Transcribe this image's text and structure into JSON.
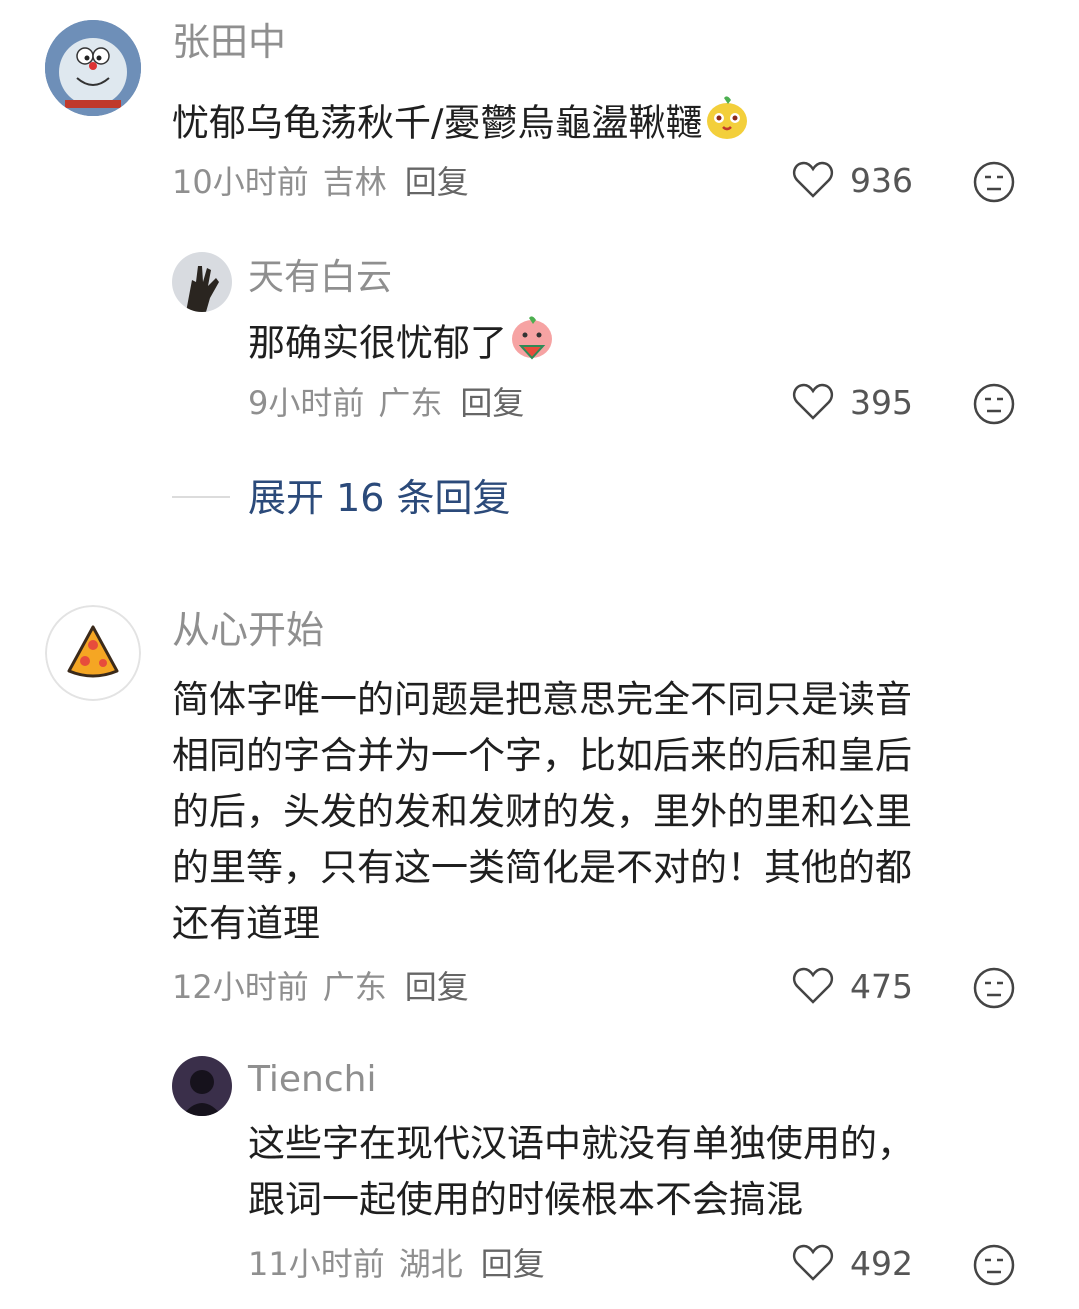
{
  "comments": [
    {
      "user": "张田中",
      "text": "忧郁乌龟荡秋千/憂鬱烏龜盪鞦韆",
      "time": "10小时前",
      "location": "吉林",
      "reply_label": "回复",
      "likes": "936",
      "avatar_icon": "doraemon-avatar",
      "reactions": "neutral-face-icon",
      "replies": [
        {
          "user": "天有白云",
          "text": "那确实很忧郁了",
          "time": "9小时前",
          "location": "广东",
          "reply_label": "回复",
          "likes": "395"
        }
      ],
      "expand_label": "展开 16 条回复"
    },
    {
      "user": "从心开始",
      "text_lines": [
        "简体字唯一的问题是把意思完全不同只是读音",
        "相同的字合并为一个字，比如后来的后和皇后",
        "的后，头发的发和发财的发，里外的里和公里",
        "的里等，只有这一类简化是不对的！其他的都",
        "还有道理"
      ],
      "time": "12小时前",
      "location": "广东",
      "reply_label": "回复",
      "likes": "475",
      "replies": [
        {
          "user": "Tienchi",
          "text_lines": [
            "这些字在现代汉语中就没有单独使用的，",
            "跟词一起使用的时候根本不会搞混"
          ],
          "time": "11小时前",
          "location": "湖北",
          "reply_label": "回复",
          "likes": "492"
        }
      ]
    }
  ],
  "colors": {
    "meta": "#8f8f8f",
    "expand": "#2b4a7a",
    "text": "#1f1f1f"
  }
}
